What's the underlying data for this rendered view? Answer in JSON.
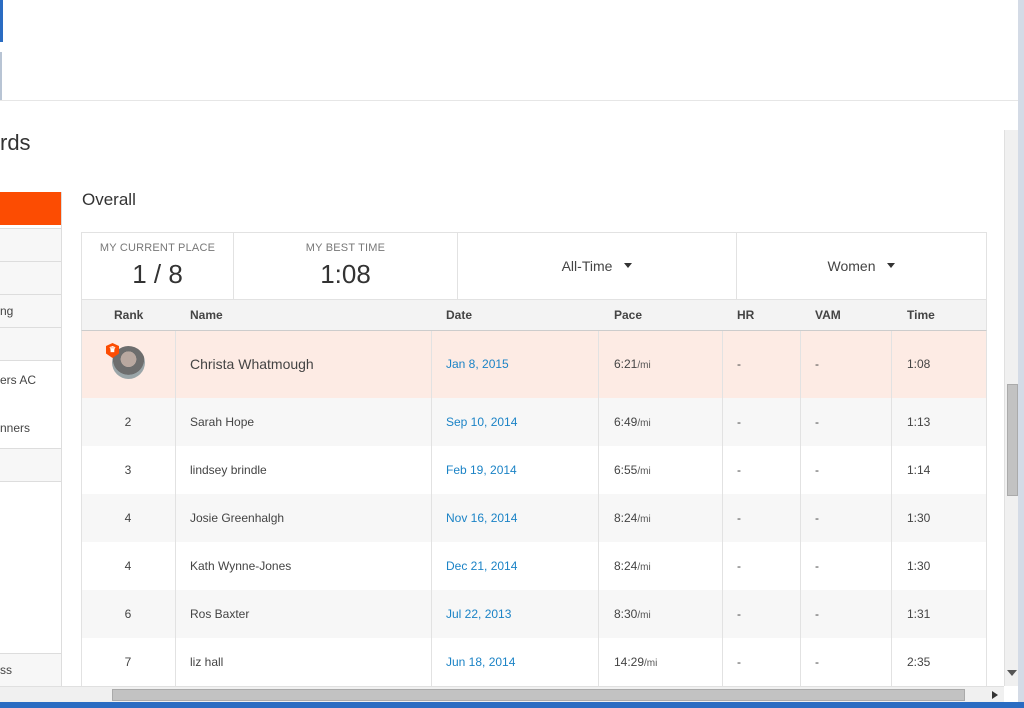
{
  "page": {
    "heading": "rds"
  },
  "sidebar": {
    "items": [
      {
        "label": ""
      },
      {
        "label": ""
      },
      {
        "label": "ng"
      },
      {
        "label": ""
      },
      {
        "label": "ers AC"
      },
      {
        "label": "nners"
      },
      {
        "label": ""
      },
      {
        "label": "ss"
      }
    ]
  },
  "section": {
    "title": "Overall"
  },
  "summary": {
    "current_place_label": "MY CURRENT PLACE",
    "current_place_value": "1 / 8",
    "best_time_label": "MY BEST TIME",
    "best_time_value": "1:08",
    "range_filter": "All-Time",
    "gender_filter": "Women"
  },
  "table": {
    "headers": {
      "rank": "Rank",
      "name": "Name",
      "date": "Date",
      "pace": "Pace",
      "hr": "HR",
      "vam": "VAM",
      "time": "Time"
    },
    "pace_unit": "/mi",
    "rows": [
      {
        "rank": "",
        "name": "Christa Whatmough",
        "date": "Jan 8, 2015",
        "pace": "6:21",
        "hr": "-",
        "vam": "-",
        "time": "1:08",
        "current_user": true
      },
      {
        "rank": "2",
        "name": "Sarah Hope",
        "date": "Sep 10, 2014",
        "pace": "6:49",
        "hr": "-",
        "vam": "-",
        "time": "1:13"
      },
      {
        "rank": "3",
        "name": "lindsey brindle",
        "date": "Feb 19, 2014",
        "pace": "6:55",
        "hr": "-",
        "vam": "-",
        "time": "1:14"
      },
      {
        "rank": "4",
        "name": "Josie Greenhalgh",
        "date": "Nov 16, 2014",
        "pace": "8:24",
        "hr": "-",
        "vam": "-",
        "time": "1:30"
      },
      {
        "rank": "4",
        "name": "Kath Wynne-Jones",
        "date": "Dec 21, 2014",
        "pace": "8:24",
        "hr": "-",
        "vam": "-",
        "time": "1:30"
      },
      {
        "rank": "6",
        "name": "Ros Baxter",
        "date": "Jul 22, 2013",
        "pace": "8:30",
        "hr": "-",
        "vam": "-",
        "time": "1:31"
      },
      {
        "rank": "7",
        "name": "liz hall",
        "date": "Jun 18, 2014",
        "pace": "14:29",
        "hr": "-",
        "vam": "-",
        "time": "2:35"
      }
    ]
  },
  "colors": {
    "accent": "#fc4c02",
    "link": "#1b83c6",
    "highlight_row": "#fdebe4"
  },
  "icons": {
    "badge": "crown-badge-icon",
    "avatar": "user-avatar"
  }
}
